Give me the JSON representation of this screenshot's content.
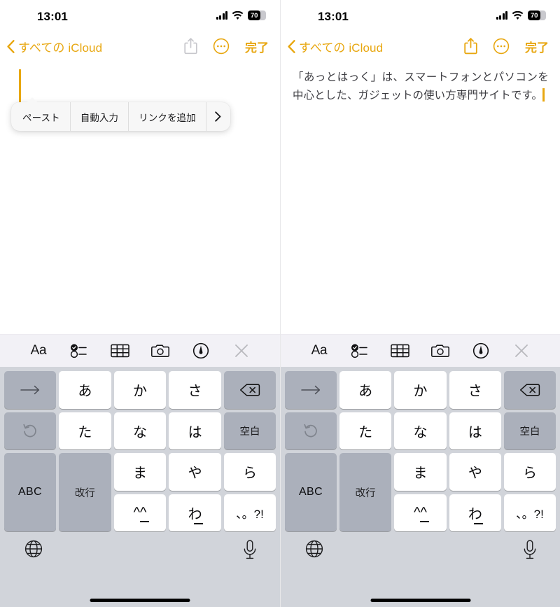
{
  "panels": [
    {
      "id": "left",
      "statusbar": {
        "time": "13:01",
        "battery_percent": "70",
        "cellular_icon": "cellular-bars-icon",
        "wifi_icon": "wifi-icon",
        "battery_icon": "battery-icon"
      },
      "navbar": {
        "back_label": "すべての iCloud",
        "back_icon": "chevron-left-icon",
        "share_icon": "share-icon",
        "share_enabled": false,
        "more_icon": "more-ellipsis-circle-icon",
        "done_label": "完了"
      },
      "note": {
        "text": "",
        "caret_visible": true
      },
      "paste_menu": {
        "visible": true,
        "items": [
          "ペースト",
          "自動入力",
          "リンクを追加"
        ],
        "more_icon": "chevron-right-icon"
      },
      "toolbar": {
        "items": [
          {
            "name": "format-aa-button",
            "label": "Aa"
          },
          {
            "name": "checklist-button",
            "label": ""
          },
          {
            "name": "table-button",
            "label": ""
          },
          {
            "name": "camera-button",
            "label": ""
          },
          {
            "name": "markup-pen-button",
            "label": ""
          },
          {
            "name": "close-keyboard-button",
            "label": ""
          }
        ]
      },
      "keyboard": {
        "keys": [
          {
            "label": "→",
            "style": "dark",
            "name": "key-arrow-right"
          },
          {
            "label": "あ",
            "style": "light",
            "name": "key-a"
          },
          {
            "label": "か",
            "style": "light",
            "name": "key-ka"
          },
          {
            "label": "さ",
            "style": "light",
            "name": "key-sa"
          },
          {
            "label": "",
            "style": "dark",
            "name": "key-delete"
          },
          {
            "label": "",
            "style": "dark",
            "name": "key-undo"
          },
          {
            "label": "た",
            "style": "light",
            "name": "key-ta"
          },
          {
            "label": "な",
            "style": "light",
            "name": "key-na"
          },
          {
            "label": "は",
            "style": "light",
            "name": "key-ha"
          },
          {
            "label": "空白",
            "style": "dark",
            "name": "key-space"
          },
          {
            "label": "ABC",
            "style": "dark",
            "name": "key-abc"
          },
          {
            "label": "ま",
            "style": "light",
            "name": "key-ma"
          },
          {
            "label": "や",
            "style": "light",
            "name": "key-ya"
          },
          {
            "label": "ら",
            "style": "light",
            "name": "key-ra"
          },
          {
            "label": "改行",
            "style": "dark",
            "name": "key-return"
          },
          {
            "label": "^^",
            "style": "light",
            "name": "key-emoticon"
          },
          {
            "label": "わ",
            "style": "light",
            "name": "key-wa"
          },
          {
            "label": "、。?!",
            "style": "light",
            "name": "key-punctuation"
          }
        ],
        "globe_icon": "globe-icon",
        "mic_icon": "microphone-icon"
      }
    },
    {
      "id": "right",
      "statusbar": {
        "time": "13:01",
        "battery_percent": "70",
        "cellular_icon": "cellular-bars-icon",
        "wifi_icon": "wifi-icon",
        "battery_icon": "battery-icon"
      },
      "navbar": {
        "back_label": "すべての iCloud",
        "back_icon": "chevron-left-icon",
        "share_icon": "share-icon",
        "share_enabled": true,
        "more_icon": "more-ellipsis-circle-icon",
        "done_label": "完了"
      },
      "note": {
        "text": "「あっとはっく」は、スマートフォンとパソコンを中心とした、ガジェットの使い方専門サイトです。",
        "caret_visible": true
      },
      "paste_menu": {
        "visible": false,
        "items": [],
        "more_icon": ""
      },
      "toolbar": {
        "items": [
          {
            "name": "format-aa-button",
            "label": "Aa"
          },
          {
            "name": "checklist-button",
            "label": ""
          },
          {
            "name": "table-button",
            "label": ""
          },
          {
            "name": "camera-button",
            "label": ""
          },
          {
            "name": "markup-pen-button",
            "label": ""
          },
          {
            "name": "close-keyboard-button",
            "label": ""
          }
        ]
      },
      "keyboard": {
        "keys": [
          {
            "label": "→",
            "style": "dark",
            "name": "key-arrow-right"
          },
          {
            "label": "あ",
            "style": "light",
            "name": "key-a"
          },
          {
            "label": "か",
            "style": "light",
            "name": "key-ka"
          },
          {
            "label": "さ",
            "style": "light",
            "name": "key-sa"
          },
          {
            "label": "",
            "style": "dark",
            "name": "key-delete"
          },
          {
            "label": "",
            "style": "dark",
            "name": "key-undo"
          },
          {
            "label": "た",
            "style": "light",
            "name": "key-ta"
          },
          {
            "label": "な",
            "style": "light",
            "name": "key-na"
          },
          {
            "label": "は",
            "style": "light",
            "name": "key-ha"
          },
          {
            "label": "空白",
            "style": "dark",
            "name": "key-space"
          },
          {
            "label": "ABC",
            "style": "dark",
            "name": "key-abc"
          },
          {
            "label": "ま",
            "style": "light",
            "name": "key-ma"
          },
          {
            "label": "や",
            "style": "light",
            "name": "key-ya"
          },
          {
            "label": "ら",
            "style": "light",
            "name": "key-ra"
          },
          {
            "label": "改行",
            "style": "dark",
            "name": "key-return"
          },
          {
            "label": "^^",
            "style": "light",
            "name": "key-emoticon"
          },
          {
            "label": "わ",
            "style": "light",
            "name": "key-wa"
          },
          {
            "label": "、。?!",
            "style": "light",
            "name": "key-punctuation"
          }
        ],
        "globe_icon": "globe-icon",
        "mic_icon": "microphone-icon"
      }
    }
  ],
  "colors": {
    "accent_yellow": "#e8a710",
    "keyboard_background": "#d1d4da",
    "key_light": "#ffffff",
    "key_dark": "#abb0bb",
    "toolbar_background": "#f2f1f6",
    "note_text": "#3b3b40"
  }
}
